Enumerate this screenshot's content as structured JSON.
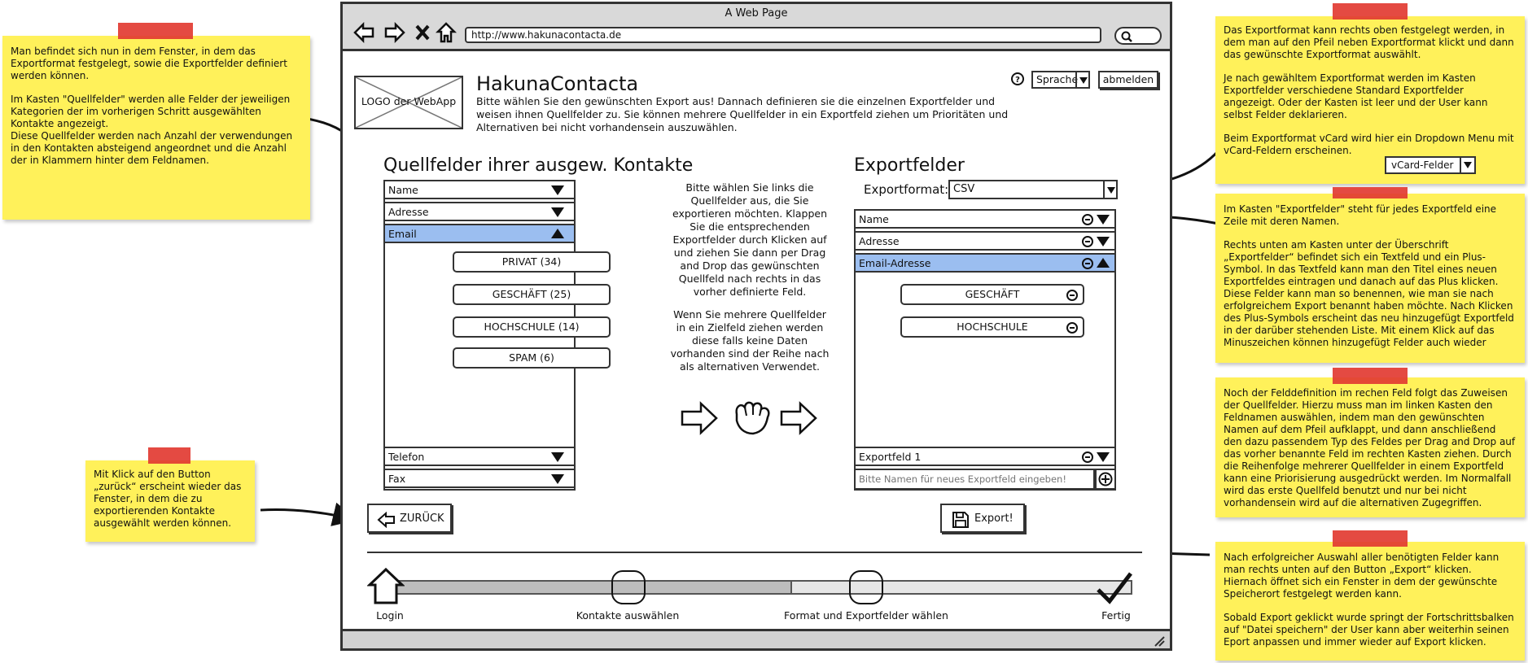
{
  "browser": {
    "window_title": "A Web Page",
    "url": "http://www.hakunacontacta.de"
  },
  "header": {
    "logo_text": "LOGO der WebApp",
    "app_title": "HakunaContacta",
    "description": "Bitte wählen Sie den gewünschten Export aus! Dannach definieren sie die einzelnen Exportfelder und weisen ihnen Quellfelder zu. Sie können mehrere Quellfelder in ein Exportfeld ziehen um Prioritäten und Alternativen bei nicht vorhandensein auszuwählen.",
    "help_label": "?",
    "language_label": "Sprache",
    "logout_label": "abmelden"
  },
  "source": {
    "heading": "Quellfelder ihrer ausgew. Kontakte",
    "items": [
      "Name",
      "Adresse",
      "Email"
    ],
    "sub_items": [
      "PRIVAT (34)",
      "GESCHÄFT (25)",
      "HOCHSCHULE (14)",
      "SPAM (6)"
    ],
    "bottom_items": [
      "Telefon",
      "Fax"
    ]
  },
  "instructions": {
    "p1": "Bitte wählen Sie links die Quellfelder aus, die Sie exportieren möchten. Klappen Sie die entsprechenden Exportfelder durch Klicken auf und ziehen Sie dann per Drag and Drop das gewünschten Quellfeld nach rechts in das vorher definierte Feld.",
    "p2": "Wenn Sie mehrere Quellfelder in ein Zielfeld ziehen werden diese falls keine Daten vorhanden sind der Reihe nach als alternativen Verwendet."
  },
  "export": {
    "heading": "Exportfelder",
    "format_label": "Exportformat:",
    "format_value": "CSV",
    "items": [
      "Name",
      "Adresse",
      "Email-Adresse"
    ],
    "sub_items": [
      "GESCHÄFT",
      "HOCHSCHULE"
    ],
    "last_item": "Exportfeld 1",
    "new_field_placeholder": "Bitte Namen für neues Exportfeld eingeben!"
  },
  "buttons": {
    "back": "ZURÜCK",
    "export": "Export!"
  },
  "progress": {
    "steps": [
      "Login",
      "Kontakte auswählen",
      "Format und Exportfelder wählen",
      "Fertig"
    ],
    "current_step": 3
  },
  "notes": {
    "left_top": [
      "Man befindet sich nun in dem Fenster, in dem das Exportformat festgelegt, sowie die Exportfelder definiert werden können.",
      "Im Kasten \"Quellfelder\" werden alle Felder der jeweiligen Kategorien der im vorherigen Schritt ausgewählten Kontakte angezeigt.\nDiese Quellfelder werden nach Anzahl der verwendungen in den Kontakten absteigend angeordnet und die Anzahl der in Klammern hinter dem Feldnamen."
    ],
    "left_bottom": "Mit Klick auf den Button „zurück“ erscheint wieder das Fenster, in dem die zu exportierenden Kontakte ausgewählt werden können.",
    "right_1": [
      "Das Exportformat kann rechts oben festgelegt werden, in dem man auf den Pfeil neben Exportformat klickt und dann das gewünschte Exportformat auswählt.",
      "Je nach gewähltem Exportformat werden im Kasten Exportfelder verschiedene Standard Exportfelder angezeigt. Oder der Kasten ist leer und der User kann selbst Felder deklarieren.",
      "Beim Exportformat vCard wird hier ein Dropdown Menu mit vCard-Feldern erscheinen."
    ],
    "right_1_dropdown": "vCard-Felder",
    "right_2": [
      "Im Kasten \"Exportfelder\" steht für jedes Exportfeld eine Zeile mit deren Namen.",
      "Rechts unten am Kasten unter der Überschrift „Exportfelder“ befindet sich ein Textfeld und ein Plus-Symbol. In das Textfeld kann man den Titel eines neuen Exportfeldes eintragen und danach auf das Plus klicken. Diese Felder kann man so benennen, wie man sie nach erfolgreichem Export benannt haben möchte. Nach Klicken des Plus-Symbols erscheint das neu hinzugefügt Exportfeld in der darüber stehenden Liste. Mit einem Klick auf das Minuszeichen können hinzugefügt Felder auch wieder"
    ],
    "right_3": "Noch der Felddefinition im rechen Feld folgt das Zuweisen der Quellfelder. Hierzu muss man im linken Kasten den Feldnamen auswählen, indem man den gewünschten Namen auf dem Pfeil aufklappt, und dann anschließend den dazu passendem Typ des Feldes per Drag and Drop auf das vorher benannte Feld im rechten Kasten ziehen. Durch die Reihenfolge mehrerer Quellfelder in einem Exportfeld kann eine Priorisierung ausgedrückt werden. Im Normalfall wird das erste Quellfeld benutzt und nur bei nicht vorhandensein wird auf die alternativen Zugegriffen.",
    "right_4": [
      "Nach erfolgreicher Auswahl aller benötigten Felder kann man rechts unten auf den Button „Export“ klicken. Hiernach öffnet sich ein Fenster in dem der gewünschte Speicherort festgelegt werden kann.",
      "Sobald Export geklickt wurde springt der Fortschrittsbalken auf \"Datei speichern\" der User kann aber weiterhin seinen Eport anpassen und immer wieder auf Export klicken."
    ]
  },
  "colors": {
    "note": "#fff15a",
    "tape": "#e23b32",
    "selected_row": "#9bbef0",
    "chrome": "#d9d9d9"
  }
}
